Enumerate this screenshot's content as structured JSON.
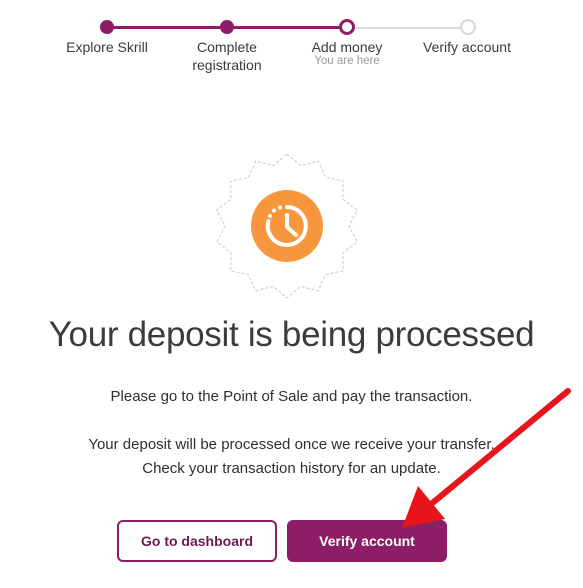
{
  "stepper": {
    "steps": [
      {
        "label": "Explore Skrill",
        "state": "done"
      },
      {
        "label": "Complete registration",
        "state": "done"
      },
      {
        "label": "Add money",
        "state": "current",
        "sub": "You are here"
      },
      {
        "label": "Verify account",
        "state": "todo"
      }
    ]
  },
  "status_icon": "clock-pending-icon",
  "content": {
    "title": "Your deposit is being processed",
    "line1": "Please go to the Point of Sale and pay the transaction.",
    "line2": "Your deposit will be processed once we receive your transfer.",
    "line3": "Check your transaction history for an update."
  },
  "actions": {
    "dashboard_label": "Go to dashboard",
    "verify_label": "Verify account"
  },
  "colors": {
    "brand": "#8b1e67",
    "accent": "#f7963d",
    "annotation_arrow": "#e8141b"
  }
}
